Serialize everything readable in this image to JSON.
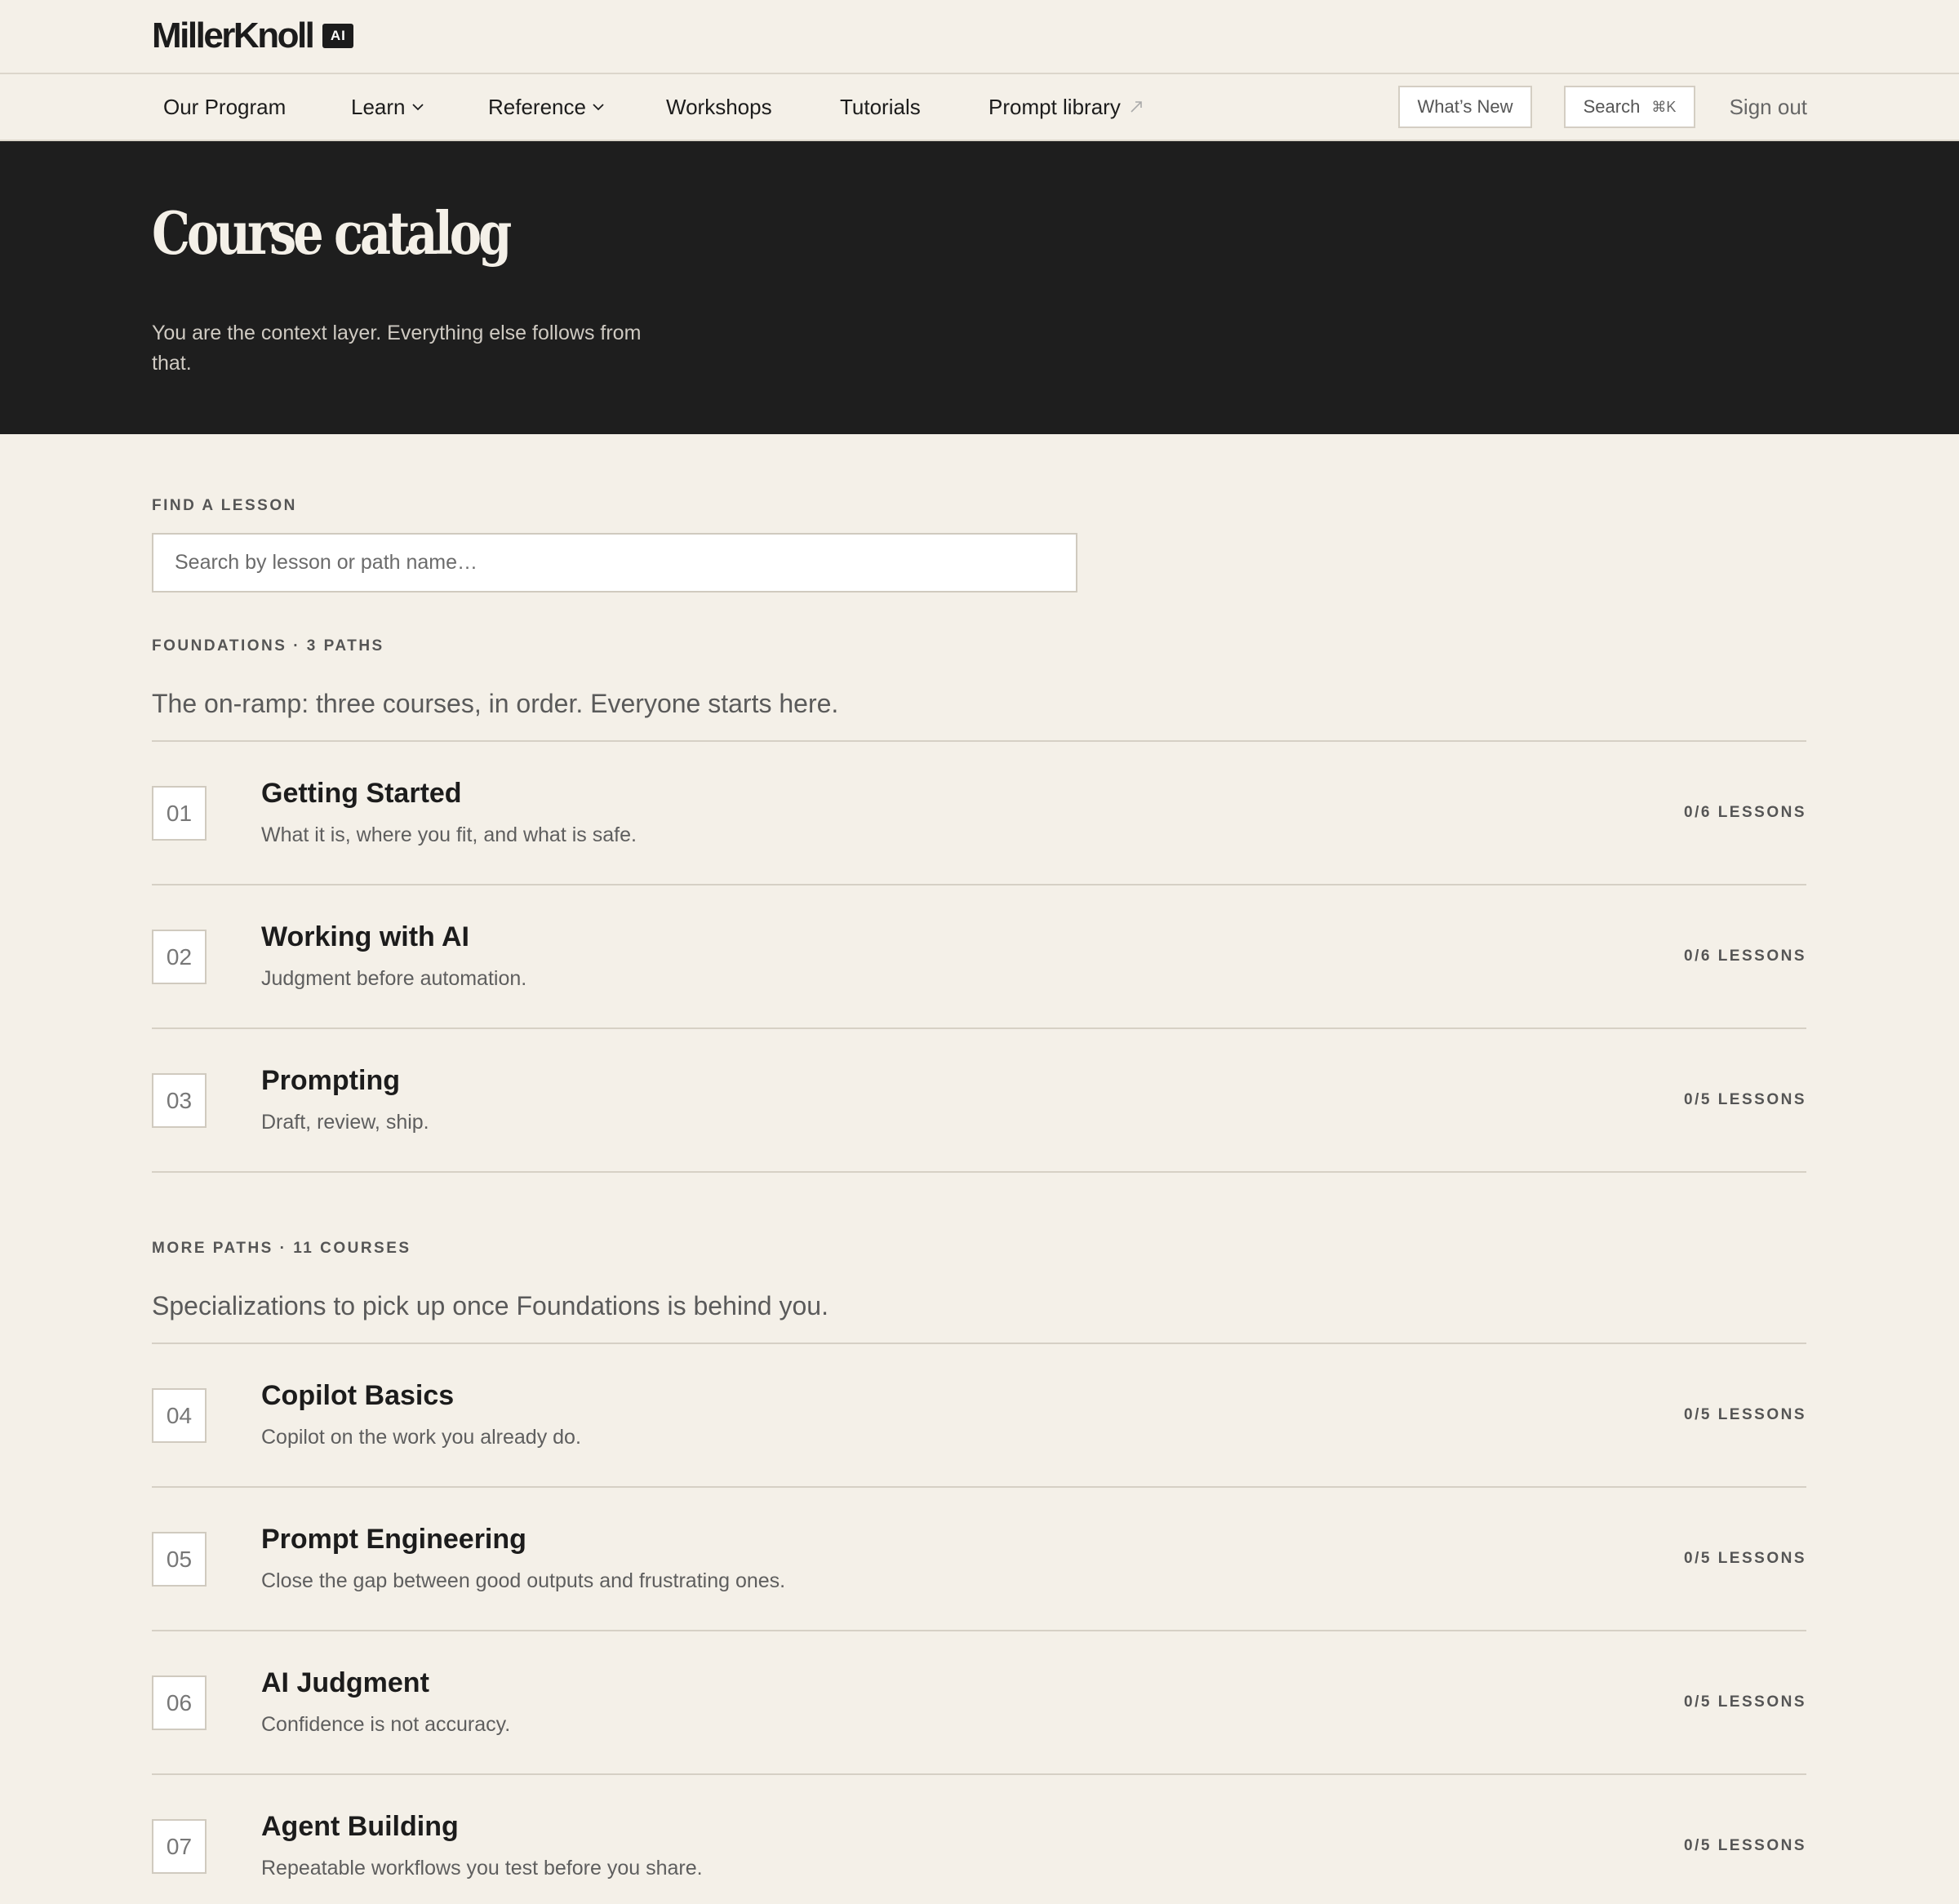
{
  "brand": {
    "name": "MillerKnoll",
    "badge": "AI"
  },
  "nav": {
    "items": [
      {
        "label": "Our Program",
        "dropdown": false,
        "external": false
      },
      {
        "label": "Learn",
        "dropdown": true,
        "external": false
      },
      {
        "label": "Reference",
        "dropdown": true,
        "external": false
      },
      {
        "label": "Workshops",
        "dropdown": false,
        "external": false
      },
      {
        "label": "Tutorials",
        "dropdown": false,
        "external": false
      },
      {
        "label": "Prompt library",
        "dropdown": false,
        "external": true
      }
    ],
    "whats_new": "What’s New",
    "search_label": "Search",
    "search_shortcut": "⌘K",
    "sign_out": "Sign out"
  },
  "hero": {
    "title": "Course catalog",
    "subtitle": "You are the context layer. Everything else follows from that."
  },
  "find": {
    "label": "FIND A LESSON",
    "placeholder": "Search by lesson or path name…"
  },
  "foundations": {
    "label": "FOUNDATIONS · 3 PATHS",
    "description": "The on-ramp: three courses, in order. Everyone starts here.",
    "courses": [
      {
        "num": "01",
        "title": "Getting Started",
        "desc": "What it is, where you fit, and what is safe.",
        "count": "0/6 LESSONS"
      },
      {
        "num": "02",
        "title": "Working with AI",
        "desc": "Judgment before automation.",
        "count": "0/6 LESSONS"
      },
      {
        "num": "03",
        "title": "Prompting",
        "desc": "Draft, review, ship.",
        "count": "0/5 LESSONS"
      }
    ]
  },
  "more": {
    "label": "MORE PATHS · 11 COURSES",
    "description": "Specializations to pick up once Foundations is behind you.",
    "courses": [
      {
        "num": "04",
        "title": "Copilot Basics",
        "desc": "Copilot on the work you already do.",
        "count": "0/5 LESSONS"
      },
      {
        "num": "05",
        "title": "Prompt Engineering",
        "desc": "Close the gap between good outputs and frustrating ones.",
        "count": "0/5 LESSONS"
      },
      {
        "num": "06",
        "title": "AI Judgment",
        "desc": "Confidence is not accuracy.",
        "count": "0/5 LESSONS"
      },
      {
        "num": "07",
        "title": "Agent Building",
        "desc": "Repeatable workflows you test before you share.",
        "count": "0/5 LESSONS"
      }
    ]
  }
}
